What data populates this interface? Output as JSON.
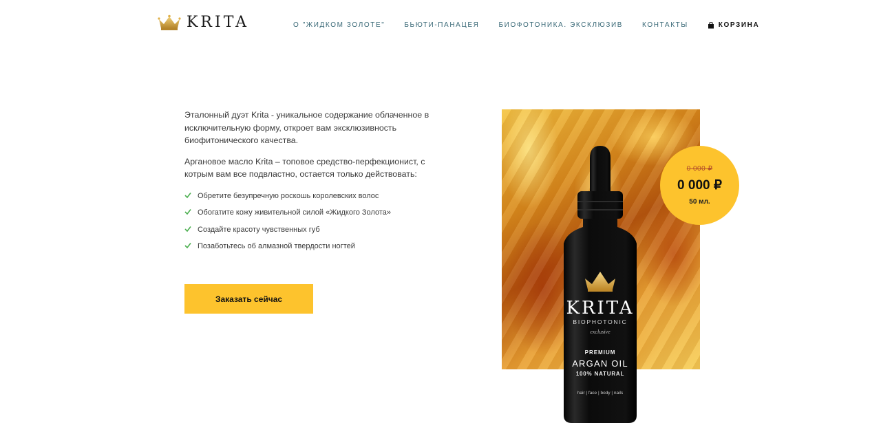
{
  "brand": {
    "logo_text": "KRITA",
    "logo_icon": "crown-icon"
  },
  "nav": {
    "items": [
      {
        "label": "О \"ЖИДКОМ ЗОЛОТЕ\""
      },
      {
        "label": "БЬЮТИ-ПАНАЦЕЯ"
      },
      {
        "label": "БИОФОТОНИКА. ЭКСКЛЮЗИВ"
      },
      {
        "label": "КОНТАКТЫ"
      }
    ],
    "cart_label": "КОРЗИНА",
    "cart_icon": "shopping-bag-icon"
  },
  "content": {
    "paragraph1": "Эталонный дуэт Krita - уникальное содержание облаченное в исключительную форму, откроет вам эксклюзивность биофитонического качества.",
    "paragraph2": "Аргановое масло Krita – топовое средство-перфекционист, с котрым вам все подвластно, остается только действовать:",
    "features": [
      "Обретите безупречную роскошь королевских волос",
      "Обогатите кожу живительной силой «Жидкого Золота»",
      "Создайте красоту чувственных губ",
      "Позаботьтесь об алмазной твердости ногтей"
    ],
    "order_button": "Заказать сейчас"
  },
  "product": {
    "label_brand": "KRITA",
    "label_line": "BIOPHOTONIC",
    "label_sub": "exclusive",
    "label_premium": "PREMIUM",
    "label_name": "ARGAN OIL",
    "label_natural": "100% NATURAL",
    "label_uses": "hair | face | body | nails"
  },
  "price": {
    "old": "0 000 ₽",
    "current": "0 000 ₽",
    "volume": "50 мл."
  },
  "colors": {
    "accent": "#fdc32d",
    "nav_text": "#3b6a78",
    "check": "#4caf50"
  }
}
